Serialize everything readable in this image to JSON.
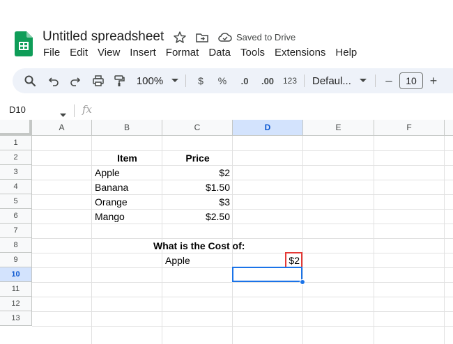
{
  "app": {
    "title": "Untitled spreadsheet",
    "save_status": "Saved to Drive",
    "brand_color": "#0f9d58"
  },
  "menu": [
    "File",
    "Edit",
    "View",
    "Insert",
    "Format",
    "Data",
    "Tools",
    "Extensions",
    "Help"
  ],
  "toolbar": {
    "zoom": "100%",
    "currency": "$",
    "percent": "%",
    "decrease_decimal": ".0",
    "increase_decimal": ".00",
    "number_format": "123",
    "font": "Defaul...",
    "font_size": "10",
    "minus": "–",
    "plus": "+",
    "icons": [
      "search-icon",
      "undo-icon",
      "redo-icon",
      "print-icon",
      "paint-format-icon",
      "zoom-dropdown-icon",
      "font-dropdown-icon"
    ]
  },
  "formula_bar": {
    "name_box": "D10",
    "fx": "fx"
  },
  "columns": [
    "A",
    "B",
    "C",
    "D",
    "E",
    "F"
  ],
  "rows": [
    "1",
    "2",
    "3",
    "4",
    "5",
    "6",
    "7",
    "8",
    "9",
    "10",
    "11",
    "12",
    "13"
  ],
  "selected": {
    "column": "D",
    "row": "10",
    "accent": "#1a73e8"
  },
  "cells": {
    "header_item": "Item",
    "header_price": "Price",
    "items": [
      {
        "name": "Apple",
        "price": "$2"
      },
      {
        "name": "Banana",
        "price": "$1.50"
      },
      {
        "name": "Orange",
        "price": "$3"
      },
      {
        "name": "Mango",
        "price": "$2.50"
      }
    ],
    "question": "What is the Cost of:",
    "query_item": "Apple",
    "query_result": "$2"
  },
  "highlight_color": "#e53935"
}
